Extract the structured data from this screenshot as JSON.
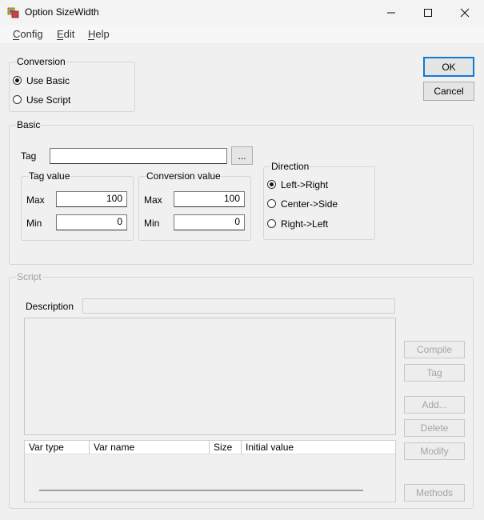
{
  "window": {
    "title": "Option SizeWidth"
  },
  "menu": {
    "config": "Config",
    "edit": "Edit",
    "help": "Help"
  },
  "conversion": {
    "label": "Conversion",
    "use_basic": "Use Basic",
    "use_script": "Use Script",
    "selected": "use_basic"
  },
  "buttons": {
    "ok": "OK",
    "cancel": "Cancel"
  },
  "basic": {
    "label": "Basic",
    "tag_label": "Tag",
    "tag_value": "",
    "browse_label": "...",
    "tag_value_group": {
      "label": "Tag value",
      "max_label": "Max",
      "max": "100",
      "min_label": "Min",
      "min": "0"
    },
    "conversion_value_group": {
      "label": "Conversion value",
      "max_label": "Max",
      "max": "100",
      "min_label": "Min",
      "min": "0"
    },
    "direction": {
      "label": "Direction",
      "options": [
        "Left->Right",
        "Center->Side",
        "Right->Left"
      ],
      "selected": 0
    }
  },
  "script": {
    "label": "Script",
    "description_label": "Description",
    "description_value": "",
    "buttons": {
      "compile": "Compile",
      "tag": "Tag",
      "add": "Add...",
      "delete": "Delete",
      "modify": "Modify",
      "methods": "Methods"
    },
    "columns": [
      "Var type",
      "Var name",
      "Size",
      "Initial value"
    ]
  }
}
